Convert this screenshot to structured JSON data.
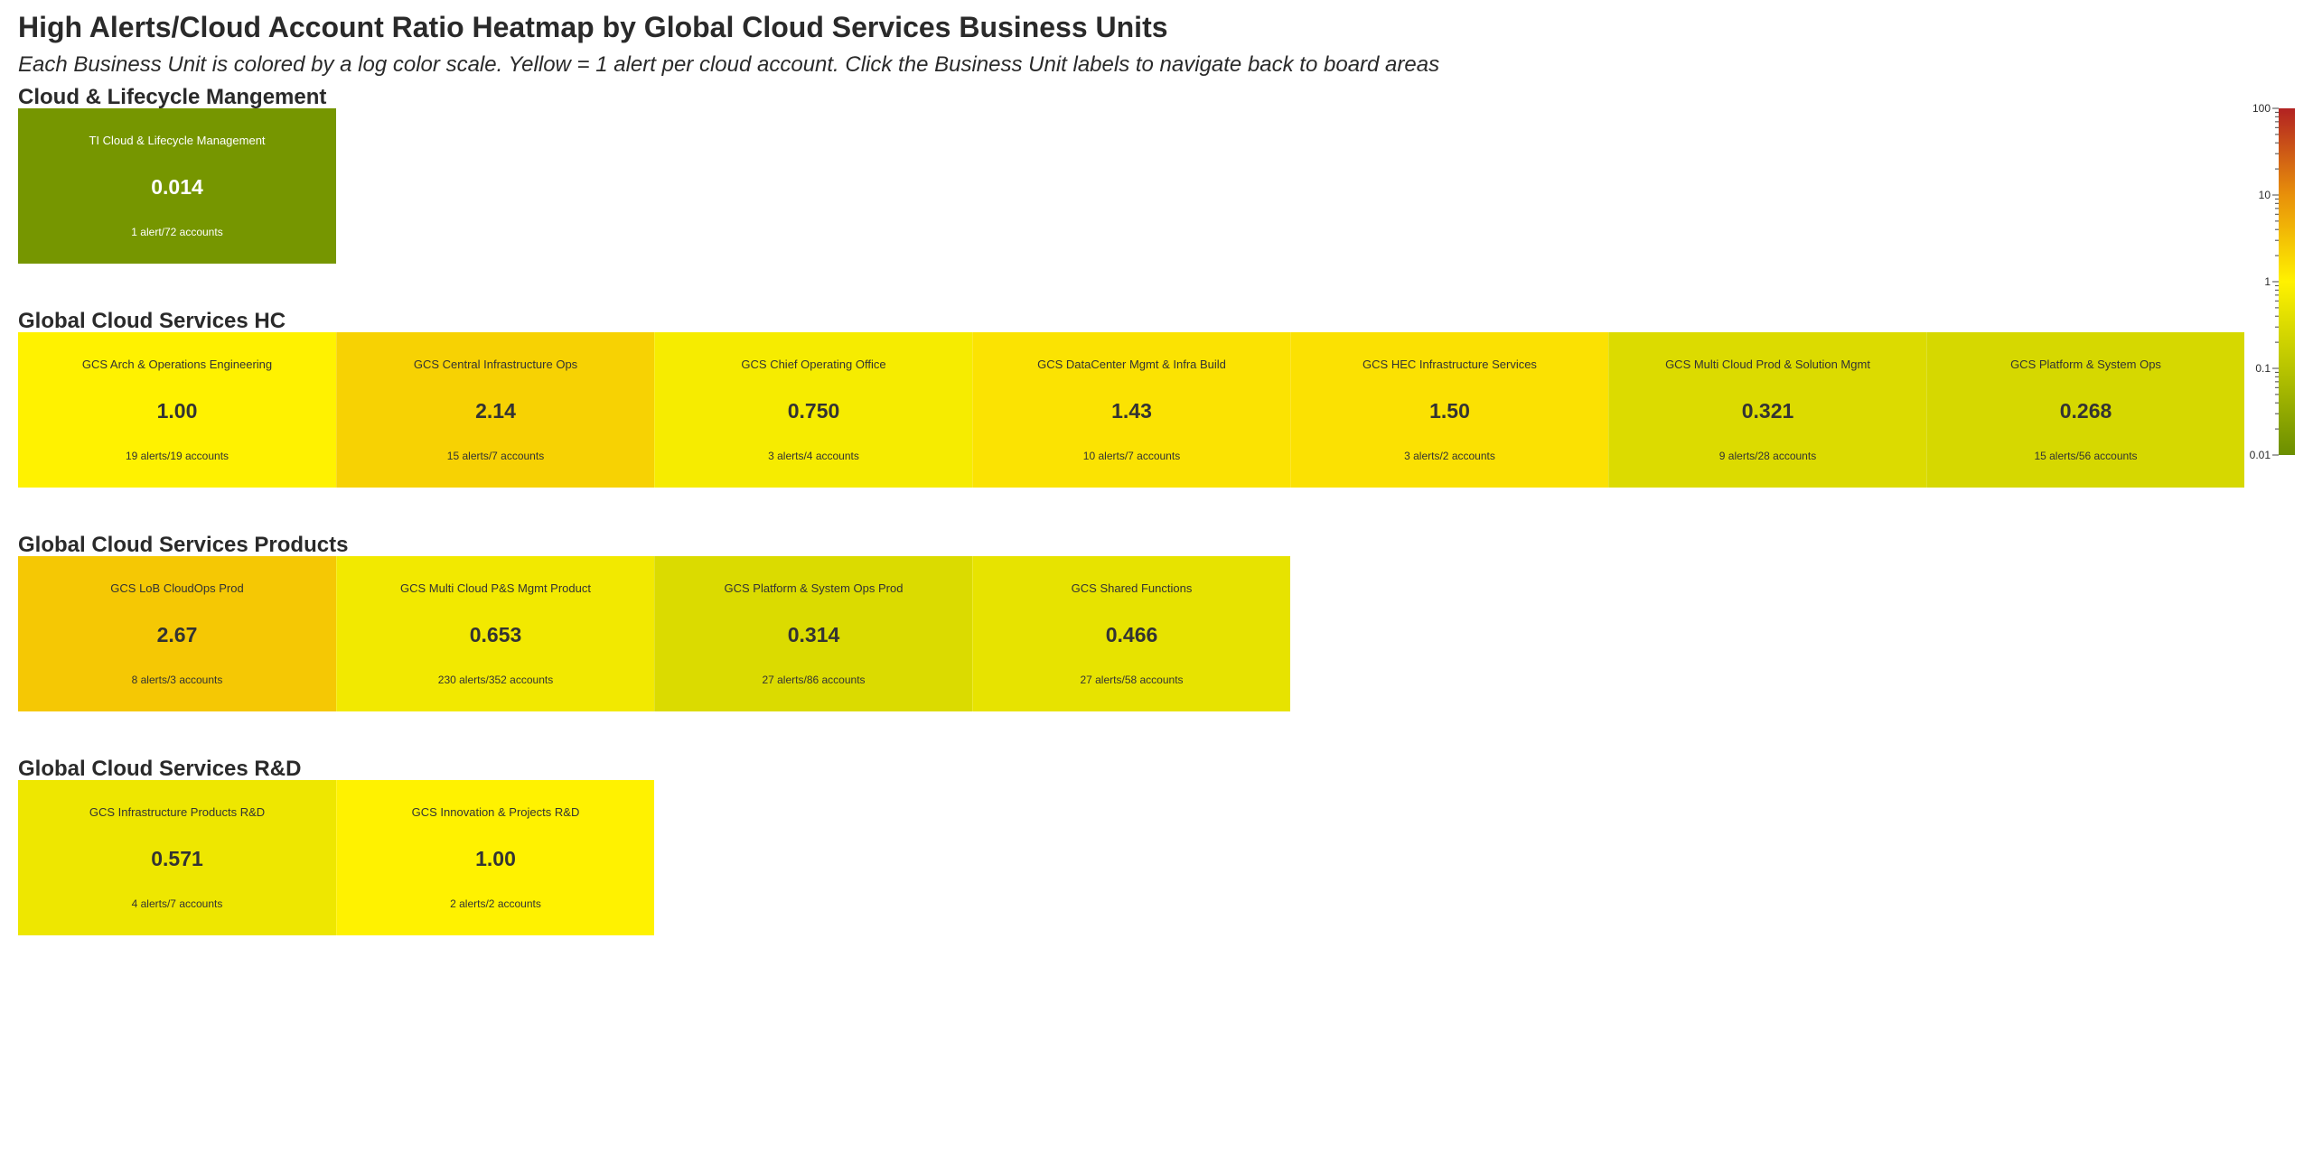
{
  "title": "High Alerts/Cloud Account Ratio Heatmap by Global Cloud Services Business Units",
  "subtitle": "Each Business Unit is colored by a log color scale. Yellow = 1 alert per cloud account. Click the Business Unit labels to navigate back to board areas",
  "colors": {
    "low": "#6b8e00",
    "mid": "#fff200",
    "high": "#b22222",
    "text_dark": "#ffffff",
    "text_light": "#333333"
  },
  "chart_data": {
    "type": "heatmap",
    "color_scale": "log",
    "colorbar": {
      "ticks": [
        100,
        10,
        1,
        0.1,
        0.01
      ],
      "tick_labels": [
        "100",
        "10",
        "1",
        "0.1",
        "0.01"
      ],
      "range": [
        0.01,
        100
      ]
    },
    "groups": [
      {
        "name": "Cloud & Lifecycle Mangement",
        "tiles": [
          {
            "name": "TI Cloud & Lifecycle Management",
            "value": 0.014,
            "value_label": "0.014",
            "count_label": "1 alert/72 accounts"
          }
        ]
      },
      {
        "name": "Global Cloud Services HC",
        "tiles": [
          {
            "name": "GCS Arch & Operations Engineering",
            "value": 1.0,
            "value_label": "1.00",
            "count_label": "19 alerts/19 accounts"
          },
          {
            "name": "GCS Central Infrastructure Ops",
            "value": 2.14,
            "value_label": "2.14",
            "count_label": "15 alerts/7 accounts"
          },
          {
            "name": "GCS Chief Operating Office",
            "value": 0.75,
            "value_label": "0.750",
            "count_label": "3 alerts/4 accounts"
          },
          {
            "name": "GCS DataCenter Mgmt & Infra Build",
            "value": 1.43,
            "value_label": "1.43",
            "count_label": "10 alerts/7 accounts"
          },
          {
            "name": "GCS HEC Infrastructure Services",
            "value": 1.5,
            "value_label": "1.50",
            "count_label": "3 alerts/2 accounts"
          },
          {
            "name": "GCS Multi Cloud Prod & Solution Mgmt",
            "value": 0.321,
            "value_label": "0.321",
            "count_label": "9 alerts/28 accounts"
          },
          {
            "name": "GCS Platform & System Ops",
            "value": 0.268,
            "value_label": "0.268",
            "count_label": "15 alerts/56 accounts"
          }
        ]
      },
      {
        "name": "Global Cloud Services Products",
        "tiles": [
          {
            "name": "GCS LoB CloudOps Prod",
            "value": 2.67,
            "value_label": "2.67",
            "count_label": "8 alerts/3 accounts"
          },
          {
            "name": "GCS Multi Cloud P&S Mgmt Product",
            "value": 0.653,
            "value_label": "0.653",
            "count_label": "230 alerts/352 accounts"
          },
          {
            "name": "GCS Platform & System Ops Prod",
            "value": 0.314,
            "value_label": "0.314",
            "count_label": "27 alerts/86 accounts"
          },
          {
            "name": "GCS Shared Functions",
            "value": 0.466,
            "value_label": "0.466",
            "count_label": "27 alerts/58 accounts"
          }
        ]
      },
      {
        "name": "Global Cloud Services R&D",
        "tiles": [
          {
            "name": "GCS Infrastructure Products R&D",
            "value": 0.571,
            "value_label": "0.571",
            "count_label": "4 alerts/7 accounts"
          },
          {
            "name": "GCS Innovation & Projects R&D",
            "value": 1.0,
            "value_label": "1.00",
            "count_label": "2 alerts/2 accounts"
          }
        ]
      }
    ]
  }
}
